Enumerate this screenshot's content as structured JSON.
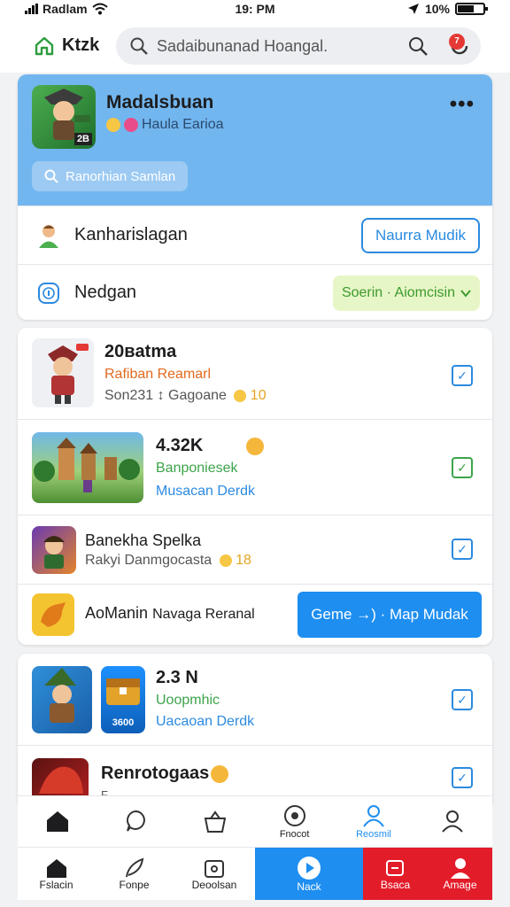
{
  "status": {
    "carrier": "Radlam",
    "time": "19: PM",
    "battery": "10%"
  },
  "header": {
    "home_label": "Ktzk",
    "search_placeholder": "Sadaibunanad Hoangal.",
    "notif_count": "7"
  },
  "profile": {
    "name": "Madalsbuan",
    "subtitle": "Haula Earioa",
    "level": "2B",
    "search_label": "Ranorhian Samlan",
    "row1_label": "Kanharislagan",
    "row1_button": "Naurra Mudik",
    "row2_label": "Nedgan",
    "row2_button": "Soerin · Aiomcisin"
  },
  "games": [
    {
      "title": "20вatma",
      "line1": "Rafiban Reamarl",
      "line2": "Son231 ↕ Gagoane",
      "line2_suffix": "10"
    },
    {
      "title": "4.32K",
      "line1": "Banponiesek",
      "line2": "Musacan Derdk"
    },
    {
      "title": "Banekha Spelka",
      "line1": "Rakyi Danmgocasta",
      "line1_suffix": "18"
    },
    {
      "title": "AoManin",
      "subtitle": "Navaga Reranal",
      "button": "Geme →) · Map Mudak"
    }
  ],
  "games2": [
    {
      "title": "2.3 N",
      "line1": "Uoopmhic",
      "line2": "Uacaoan Derdk",
      "badge": "3600"
    },
    {
      "title": "Renrotogaas",
      "line1": "F..."
    }
  ],
  "nav_top": [
    {
      "label": ""
    },
    {
      "label": ""
    },
    {
      "label": ""
    },
    {
      "label": "Fnocot"
    },
    {
      "label": "Reosmil"
    },
    {
      "label": ""
    }
  ],
  "nav_bottom": [
    {
      "label": "Fslacin"
    },
    {
      "label": "Fonpe"
    },
    {
      "label": "Deoolsan"
    },
    {
      "label": "Nack"
    },
    {
      "label": "Bsaca"
    },
    {
      "label": "Amage"
    }
  ],
  "colors": {
    "accent": "#1e8ef0",
    "hero": "#72b6ef",
    "danger": "#e31c2a",
    "success": "#3ca44a"
  }
}
